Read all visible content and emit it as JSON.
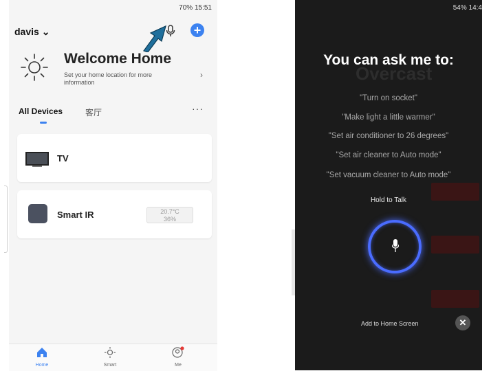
{
  "left_phone": {
    "status_bar": {
      "text": "70% 15:51"
    },
    "header": {
      "home_name": "davis",
      "home_chevron": "⌄",
      "add_icon": "+"
    },
    "welcome": {
      "title": "Welcome Home",
      "subtitle": "Set your home location for more information",
      "chevron": "›"
    },
    "tabs": {
      "all": "All Devices",
      "room": "客厅",
      "more": "···"
    },
    "devices": [
      {
        "name": "TV"
      },
      {
        "name": "Smart IR",
        "temperature": "20.7°C",
        "humidity": "36%"
      }
    ],
    "bottom_nav": [
      {
        "label": "Home"
      },
      {
        "label": "Smart"
      },
      {
        "label": "Me"
      }
    ],
    "accent_color": "#3c82f0"
  },
  "right_phone": {
    "status_bar": {
      "text": "54% 14:4"
    },
    "background_word": "Overcast",
    "title": "You can ask me to:",
    "suggestions": [
      "\"Turn on socket\"",
      "\"Make light a little warmer\"",
      "\"Set air conditioner to 26 degrees\"",
      "\"Set air cleaner to Auto mode\"",
      "\"Set vacuum cleaner to Auto mode\""
    ],
    "hold_to_talk": "Hold to Talk",
    "add_to_home": "Add to Home Screen",
    "close_glyph": "✕",
    "ring_color": "#4a6cff"
  }
}
